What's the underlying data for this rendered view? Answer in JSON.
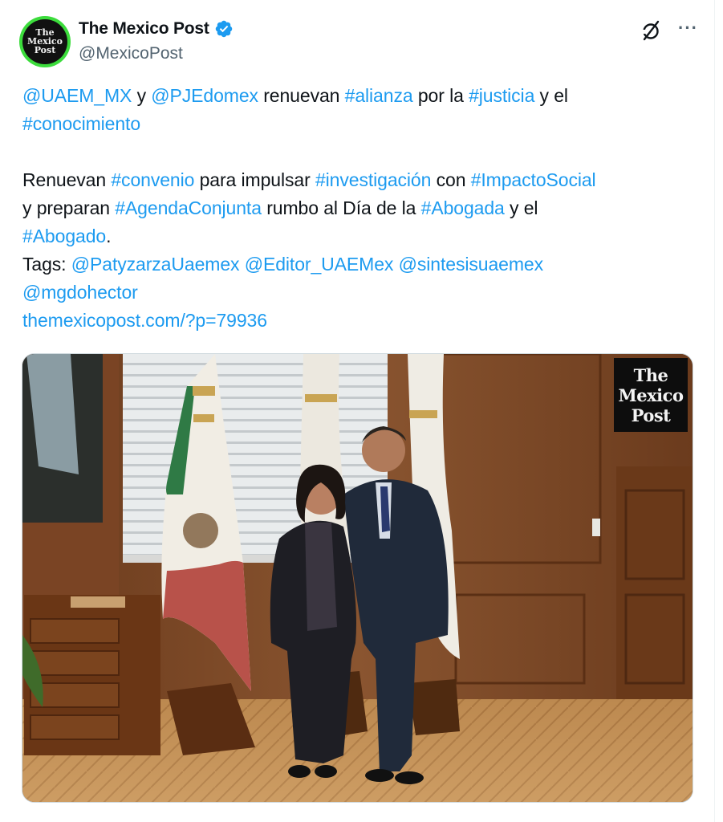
{
  "author": {
    "display_name": "The Mexico Post",
    "handle": "@MexicoPost",
    "avatar_text": [
      "The",
      "Mexico",
      "Post"
    ]
  },
  "tweet": {
    "line1": [
      {
        "text": "@UAEM_MX",
        "link": true
      },
      {
        "text": " y ",
        "link": false
      },
      {
        "text": "@PJEdomex",
        "link": true
      },
      {
        "text": " renuevan ",
        "link": false
      },
      {
        "text": "#alianza",
        "link": true
      },
      {
        "text": " por la ",
        "link": false
      },
      {
        "text": "#justicia",
        "link": true
      },
      {
        "text": " y el",
        "link": false
      }
    ],
    "line2": [
      {
        "text": "#conocimiento",
        "link": true
      }
    ],
    "line3": [
      {
        "text": "Renuevan ",
        "link": false
      },
      {
        "text": "#convenio",
        "link": true
      },
      {
        "text": " para impulsar ",
        "link": false
      },
      {
        "text": "#investigación",
        "link": true
      },
      {
        "text": " con ",
        "link": false
      },
      {
        "text": "#ImpactoSocial",
        "link": true
      }
    ],
    "line4": [
      {
        "text": "y preparan ",
        "link": false
      },
      {
        "text": "#AgendaConjunta",
        "link": true
      },
      {
        "text": " rumbo al Día de la ",
        "link": false
      },
      {
        "text": "#Abogada",
        "link": true
      },
      {
        "text": " y el",
        "link": false
      }
    ],
    "line5": [
      {
        "text": "#Abogado",
        "link": true
      },
      {
        "text": ".",
        "link": false
      }
    ],
    "line6": [
      {
        "text": "Tags: ",
        "link": false
      },
      {
        "text": "@PatyzarzaUaemex",
        "link": true
      },
      {
        "text": " ",
        "link": false
      },
      {
        "text": "@Editor_UAEMex",
        "link": true
      },
      {
        "text": " ",
        "link": false
      },
      {
        "text": "@sintesisuaemex",
        "link": true
      }
    ],
    "line7": [
      {
        "text": "@mgdohector",
        "link": true
      }
    ],
    "line8": [
      {
        "text": "themexicopost.com/?p=79936",
        "link": true
      }
    ]
  },
  "media": {
    "watermark": [
      "The",
      "Mexico",
      "Post"
    ]
  },
  "icons": {
    "verified": "verified-badge-icon",
    "grok": "grok-icon",
    "more": "more-options-icon"
  },
  "colors": {
    "link": "#1d9bf0",
    "verified": "#1d9bf0",
    "text": "#0f1419",
    "secondary": "#536471"
  }
}
